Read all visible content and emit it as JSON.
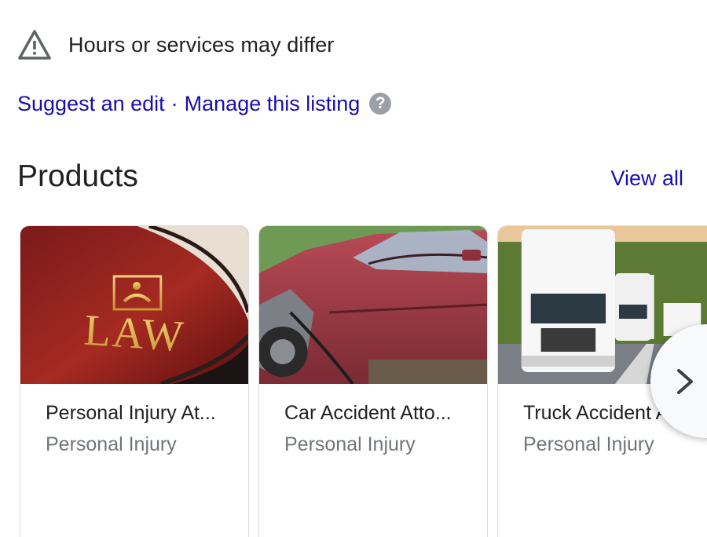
{
  "notice": {
    "text": "Hours or services may differ",
    "icon": "warning-triangle-icon"
  },
  "links": {
    "suggest": "Suggest an edit",
    "separator": "·",
    "manage": "Manage this listing",
    "help": "?"
  },
  "products": {
    "title": "Products",
    "view_all": "View all",
    "items": [
      {
        "name": "Personal Injury At...",
        "category": "Personal Injury",
        "image": "law-book-image"
      },
      {
        "name": "Car Accident Atto...",
        "category": "Personal Injury",
        "image": "wrecked-car-image"
      },
      {
        "name": "Truck Accident At...",
        "category": "Personal Injury",
        "image": "semi-trucks-image"
      }
    ],
    "next_icon": "chevron-right-icon"
  },
  "colors": {
    "link": "#1a0dab",
    "text": "#202124",
    "muted": "#70757a",
    "border": "#dadce0"
  }
}
